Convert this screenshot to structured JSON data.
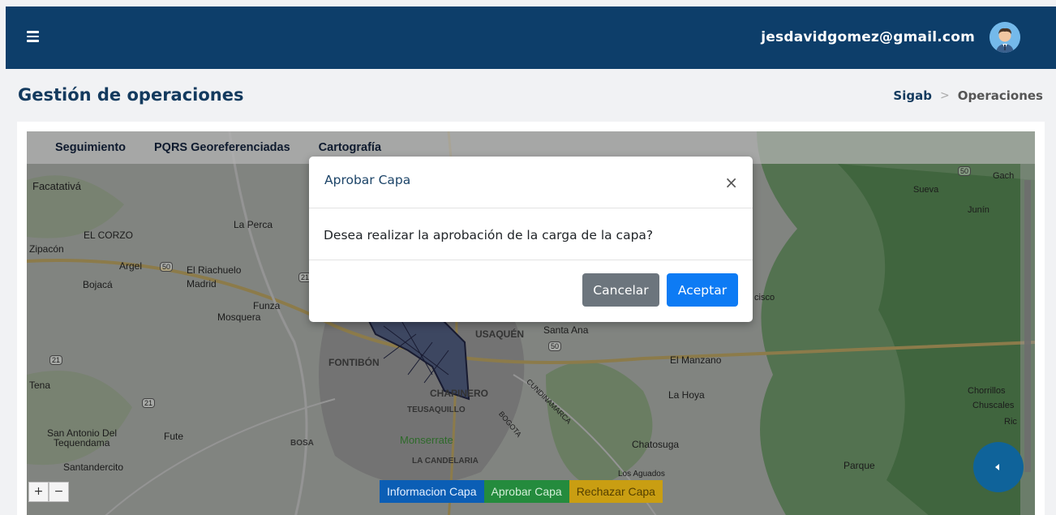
{
  "header": {
    "user_email": "jesdavidgomez@gmail.com"
  },
  "page": {
    "title": "Gestión de operaciones",
    "breadcrumb": {
      "home": "Sigab",
      "separator": ">",
      "current": "Operaciones"
    }
  },
  "map_tabs": [
    "Seguimiento",
    "PQRS Georeferenciadas",
    "Cartografía"
  ],
  "map_places": [
    "Facatativá",
    "EL CORZO",
    "La Perca",
    "Zipacón",
    "Argel",
    "El Riachuelo",
    "Bojacá",
    "Madrid",
    "Funza",
    "Mosquera",
    "FONTIBÓN",
    "Tena",
    "USAQUÉN",
    "Santa Ana",
    "El Manzano",
    "CHAPINERO",
    "TEUSAQUILLO",
    "La Hoya",
    "San Antonio Del",
    "Tequendama",
    "Fute",
    "BOSA",
    "Monserrate",
    "BOGOTA",
    "CUNDINAMARCA",
    "Chatosuga",
    "Santandercito",
    "LA CANDELARIA",
    "Los Aguados",
    "Sueva",
    "Junín",
    "Gach",
    "cisco",
    "Chorrillos",
    "Chuscales",
    "Ric",
    "Parque"
  ],
  "route_shields": [
    "50",
    "21",
    "21",
    "50",
    "50",
    "21"
  ],
  "zoom": {
    "in": "+",
    "out": "−"
  },
  "layer_actions": {
    "info": "Informacion Capa",
    "approve": "Aprobar Capa",
    "reject": "Rechazar Capa"
  },
  "modal": {
    "title": "Aprobar Capa",
    "close": "×",
    "message": "Desea realizar la aprobación de la carga de la capa?",
    "cancel": "Cancelar",
    "accept": "Aceptar"
  },
  "colors": {
    "topbar": "#0d3e6a",
    "approve": "#248b3d",
    "reject": "#c99e12",
    "info": "#0b5eb5",
    "accept": "#0d7bf4",
    "cancel": "#6c757d"
  }
}
